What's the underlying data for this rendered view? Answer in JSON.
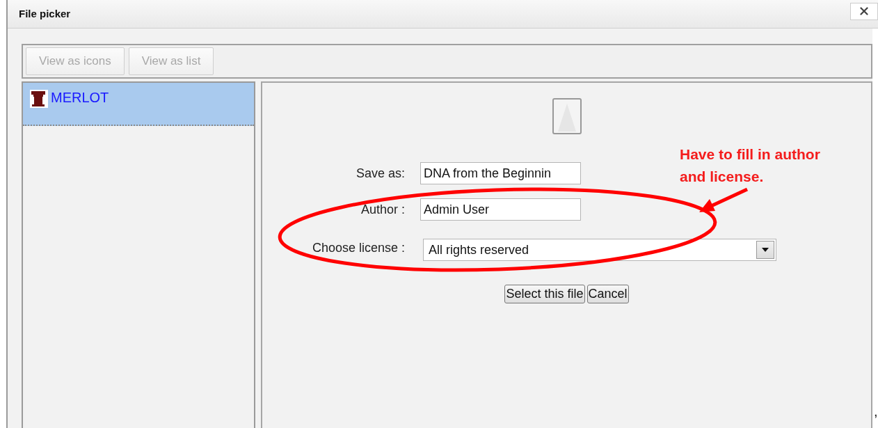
{
  "dialog": {
    "title": "File picker"
  },
  "toolbar": {
    "buttons": [
      {
        "label": "View as icons",
        "disabled": true
      },
      {
        "label": "View as list",
        "disabled": true
      }
    ]
  },
  "repositories": [
    {
      "name": "MERLOT",
      "selected": true
    }
  ],
  "form": {
    "fields": [
      {
        "kind": "text",
        "label": "Save as:",
        "value": "DNA from the Beginnin"
      },
      {
        "kind": "text",
        "label": "Author :",
        "value": "Admin User"
      },
      {
        "kind": "select",
        "label": "Choose license :",
        "value": "All rights reserved"
      }
    ],
    "buttons": [
      "Select this file",
      "Cancel"
    ]
  },
  "annotation": {
    "text": "Have to fill in author\nand license."
  },
  "trailing_mark": ","
}
